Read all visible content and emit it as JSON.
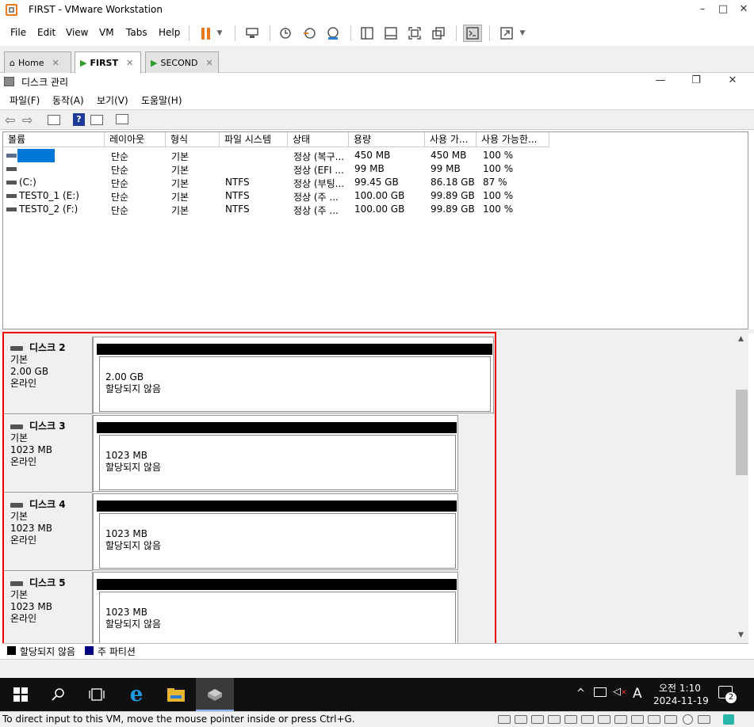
{
  "vmware": {
    "title": "FIRST - VMware Workstation",
    "menus": [
      "File",
      "Edit",
      "View",
      "VM",
      "Tabs",
      "Help"
    ],
    "tabs": [
      {
        "label": "Home",
        "active": false
      },
      {
        "label": "FIRST",
        "active": true
      },
      {
        "label": "SECOND",
        "active": false
      }
    ],
    "status_message": "To direct input to this VM, move the mouse pointer inside or press Ctrl+G."
  },
  "diskmgmt": {
    "title": "디스크 관리",
    "menus": [
      "파일(F)",
      "동작(A)",
      "보기(V)",
      "도움말(H)"
    ],
    "columns": [
      "볼륨",
      "레이아웃",
      "형식",
      "파일 시스템",
      "상태",
      "용량",
      "사용 가...",
      "사용 가능한..."
    ],
    "volumes": [
      {
        "name": "",
        "layout": "단순",
        "type": "기본",
        "fs": "",
        "status": "정상 (복구...",
        "capacity": "450 MB",
        "free": "450 MB",
        "pct": "100 %"
      },
      {
        "name": "",
        "layout": "단순",
        "type": "기본",
        "fs": "",
        "status": "정상 (EFI ...",
        "capacity": "99 MB",
        "free": "99 MB",
        "pct": "100 %"
      },
      {
        "name": "(C:)",
        "layout": "단순",
        "type": "기본",
        "fs": "NTFS",
        "status": "정상 (부팅...",
        "capacity": "99.45 GB",
        "free": "86.18 GB",
        "pct": "87 %"
      },
      {
        "name": "TEST0_1 (E:)",
        "layout": "단순",
        "type": "기본",
        "fs": "NTFS",
        "status": "정상 (주 ...",
        "capacity": "100.00 GB",
        "free": "99.89 GB",
        "pct": "100 %"
      },
      {
        "name": "TEST0_2 (F:)",
        "layout": "단순",
        "type": "기본",
        "fs": "NTFS",
        "status": "정상 (주 ...",
        "capacity": "100.00 GB",
        "free": "99.89 GB",
        "pct": "100 %"
      }
    ],
    "disks": [
      {
        "name": "디스크 2",
        "kind": "기본",
        "size": "2.00 GB",
        "state": "온라인",
        "part_size": "2.00 GB",
        "part_label": "할당되지 않음"
      },
      {
        "name": "디스크 3",
        "kind": "기본",
        "size": "1023 MB",
        "state": "온라인",
        "part_size": "1023 MB",
        "part_label": "할당되지 않음"
      },
      {
        "name": "디스크 4",
        "kind": "기본",
        "size": "1023 MB",
        "state": "온라인",
        "part_size": "1023 MB",
        "part_label": "할당되지 않음"
      },
      {
        "name": "디스크 5",
        "kind": "기본",
        "size": "1023 MB",
        "state": "온라인",
        "part_size": "1023 MB",
        "part_label": "할당되지 않음"
      }
    ],
    "legend": {
      "unallocated": "할당되지 않음",
      "primary": "주 파티션"
    }
  },
  "taskbar": {
    "clock_time": "오전 1:10",
    "clock_date": "2024-11-19",
    "ime": "A",
    "notifications": "2"
  },
  "colors": {
    "highlight": "#0078d7",
    "legend_primary": "#000080",
    "alert": "#e00000"
  }
}
